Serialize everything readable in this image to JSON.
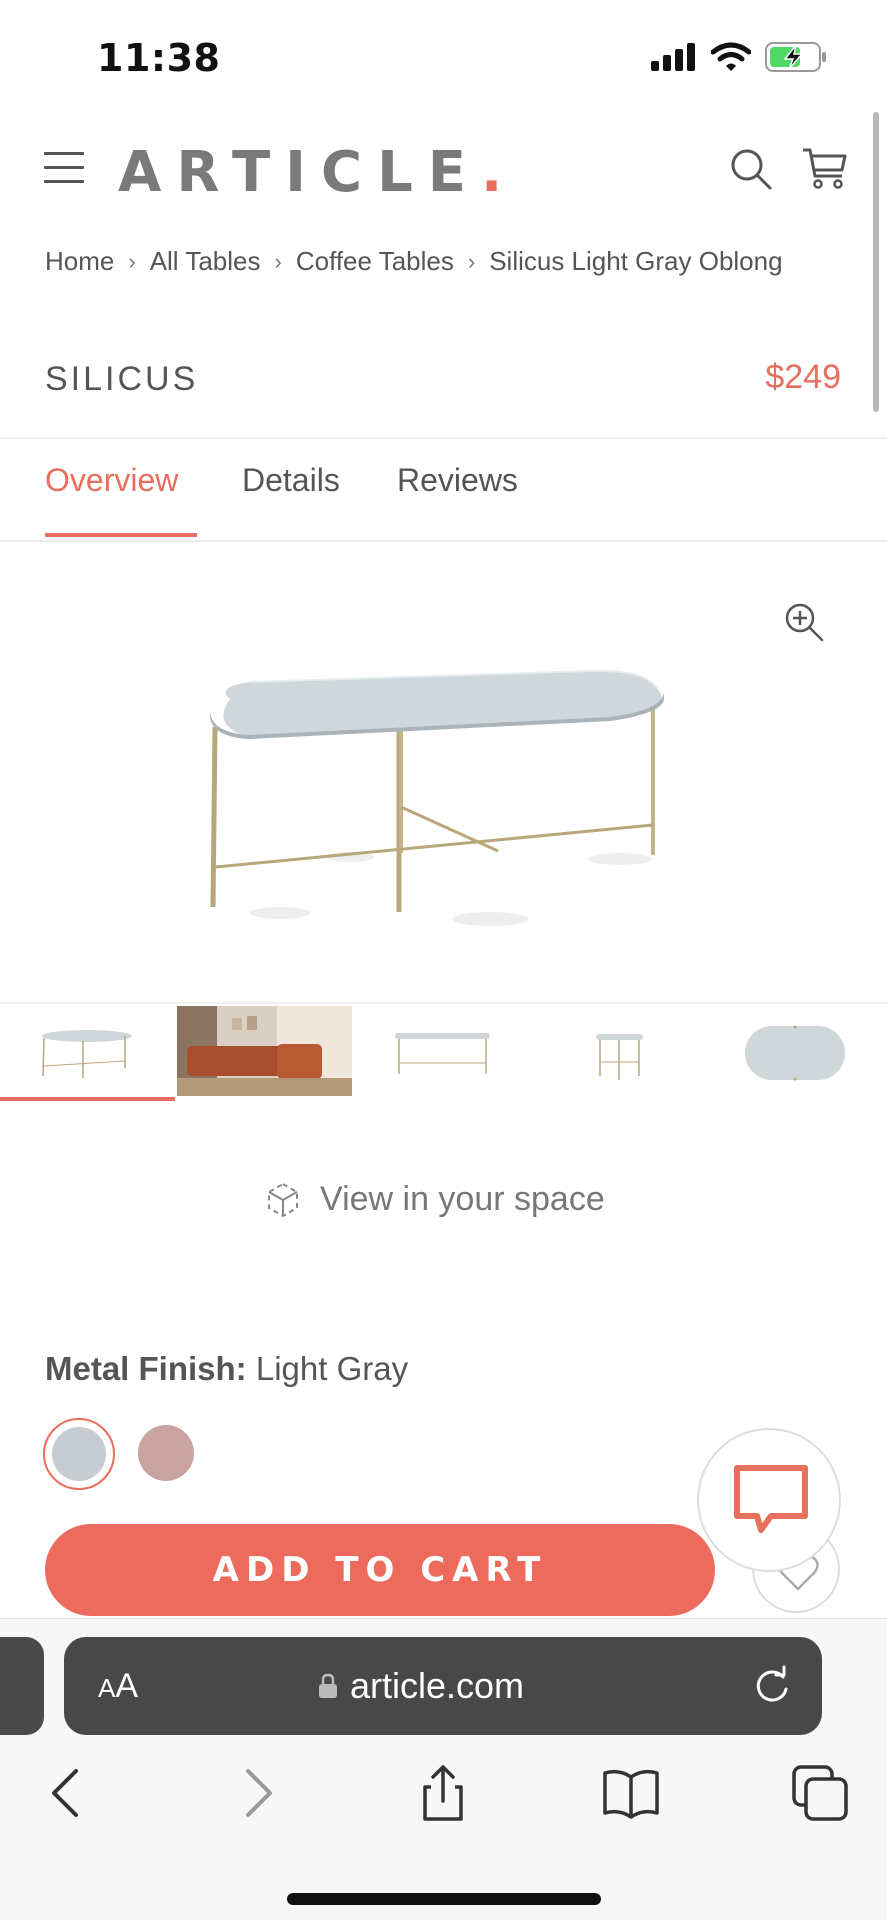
{
  "status_bar": {
    "time": "11:38"
  },
  "header": {
    "logo_text": "ARTICLE",
    "logo_dot": "."
  },
  "breadcrumb": [
    "Home",
    "All Tables",
    "Coffee Tables",
    "Silicus Light Gray Oblong"
  ],
  "product": {
    "name": "SILICUS",
    "price": "$249"
  },
  "tabs": [
    {
      "label": "Overview",
      "active": true
    },
    {
      "label": "Details",
      "active": false
    },
    {
      "label": "Reviews",
      "active": false
    }
  ],
  "gallery": {
    "thumbnail_count": 5,
    "active_index": 0
  },
  "view_in_space": "View in your space",
  "finish": {
    "label": "Metal Finish:",
    "value": "Light Gray",
    "swatches": [
      {
        "name": "Light Gray",
        "color": "#c6ccd1",
        "selected": true
      },
      {
        "name": "Rose",
        "color": "#c9a3a0",
        "selected": false
      }
    ]
  },
  "add_to_cart_label": "ADD TO CART",
  "browser": {
    "aa_label": "AA",
    "url": "article.com"
  },
  "colors": {
    "accent": "#e86e5d",
    "button": "#ec6b5d"
  }
}
